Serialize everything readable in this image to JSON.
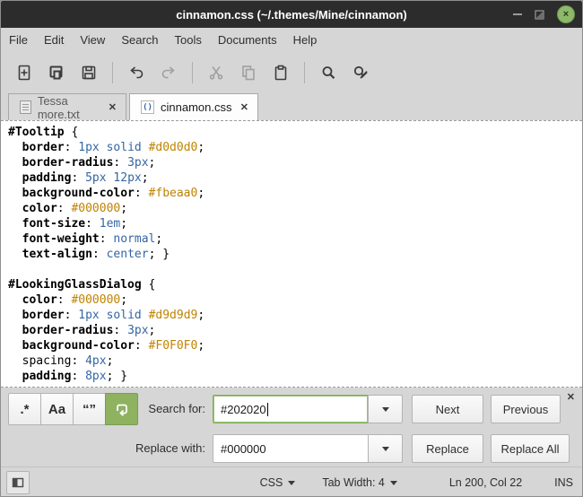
{
  "window": {
    "title": "cinnamon.css (~/.themes/Mine/cinnamon)",
    "controls": {
      "minimize": "minimize-icon",
      "maximize": "maximize-icon",
      "close": "×"
    }
  },
  "menubar": {
    "items": [
      "File",
      "Edit",
      "View",
      "Search",
      "Tools",
      "Documents",
      "Help"
    ]
  },
  "toolbar": {
    "buttons": [
      {
        "name": "new-document",
        "icon": "new-document-icon",
        "enabled": true
      },
      {
        "name": "open",
        "icon": "open-documents-icon",
        "enabled": true
      },
      {
        "name": "save",
        "icon": "save-icon",
        "enabled": true
      },
      {
        "name": "undo",
        "icon": "undo-icon",
        "enabled": true
      },
      {
        "name": "redo",
        "icon": "redo-icon",
        "enabled": false
      },
      {
        "name": "cut",
        "icon": "cut-icon",
        "enabled": false
      },
      {
        "name": "copy",
        "icon": "copy-icon",
        "enabled": false
      },
      {
        "name": "paste",
        "icon": "paste-icon",
        "enabled": true
      },
      {
        "name": "find",
        "icon": "find-icon",
        "enabled": true
      },
      {
        "name": "find-replace",
        "icon": "find-replace-icon",
        "enabled": true
      }
    ]
  },
  "tabbar": {
    "tabs": [
      {
        "label": "Tessa more.txt",
        "icon": "text-file-icon",
        "close": "✕",
        "active": false
      },
      {
        "label": "cinnamon.css",
        "icon": "css-file-icon",
        "close": "✕",
        "active": true
      }
    ]
  },
  "editor": {
    "language": "css",
    "css_icon_glyph": "()",
    "lines": [
      [
        [
          "b",
          "#Tooltip"
        ],
        [
          "p",
          " {"
        ]
      ],
      [
        [
          "p",
          "  "
        ],
        [
          "b",
          "border"
        ],
        [
          "p",
          ": "
        ],
        [
          "v",
          "1px solid"
        ],
        [
          "p",
          " "
        ],
        [
          "h",
          "#d0d0d0"
        ],
        [
          "p",
          ";"
        ]
      ],
      [
        [
          "p",
          "  "
        ],
        [
          "b",
          "border-radius"
        ],
        [
          "p",
          ": "
        ],
        [
          "v",
          "3px"
        ],
        [
          "p",
          ";"
        ]
      ],
      [
        [
          "p",
          "  "
        ],
        [
          "b",
          "padding"
        ],
        [
          "p",
          ": "
        ],
        [
          "v",
          "5px 12px"
        ],
        [
          "p",
          ";"
        ]
      ],
      [
        [
          "p",
          "  "
        ],
        [
          "b",
          "background-color"
        ],
        [
          "p",
          ": "
        ],
        [
          "h",
          "#fbeaa0"
        ],
        [
          "p",
          ";"
        ]
      ],
      [
        [
          "p",
          "  "
        ],
        [
          "b",
          "color"
        ],
        [
          "p",
          ": "
        ],
        [
          "h",
          "#000000"
        ],
        [
          "p",
          ";"
        ]
      ],
      [
        [
          "p",
          "  "
        ],
        [
          "b",
          "font-size"
        ],
        [
          "p",
          ": "
        ],
        [
          "v",
          "1em"
        ],
        [
          "p",
          ";"
        ]
      ],
      [
        [
          "p",
          "  "
        ],
        [
          "b",
          "font-weight"
        ],
        [
          "p",
          ": "
        ],
        [
          "v",
          "normal"
        ],
        [
          "p",
          ";"
        ]
      ],
      [
        [
          "p",
          "  "
        ],
        [
          "b",
          "text-align"
        ],
        [
          "p",
          ": "
        ],
        [
          "v",
          "center"
        ],
        [
          "p",
          "; }"
        ]
      ],
      [],
      [
        [
          "b",
          "#LookingGlassDialog"
        ],
        [
          "p",
          " {"
        ]
      ],
      [
        [
          "p",
          "  "
        ],
        [
          "b",
          "color"
        ],
        [
          "p",
          ": "
        ],
        [
          "h",
          "#000000"
        ],
        [
          "p",
          ";"
        ]
      ],
      [
        [
          "p",
          "  "
        ],
        [
          "b",
          "border"
        ],
        [
          "p",
          ": "
        ],
        [
          "v",
          "1px solid"
        ],
        [
          "p",
          " "
        ],
        [
          "h",
          "#d9d9d9"
        ],
        [
          "p",
          ";"
        ]
      ],
      [
        [
          "p",
          "  "
        ],
        [
          "b",
          "border-radius"
        ],
        [
          "p",
          ": "
        ],
        [
          "v",
          "3px"
        ],
        [
          "p",
          ";"
        ]
      ],
      [
        [
          "p",
          "  "
        ],
        [
          "b",
          "background-color"
        ],
        [
          "p",
          ": "
        ],
        [
          "h",
          "#F0F0F0"
        ],
        [
          "p",
          ";"
        ]
      ],
      [
        [
          "p",
          "  spacing"
        ],
        [
          "p",
          ": "
        ],
        [
          "v",
          "4px"
        ],
        [
          "p",
          ";"
        ]
      ],
      [
        [
          "p",
          "  "
        ],
        [
          "b",
          "padding"
        ],
        [
          "p",
          ": "
        ],
        [
          "v",
          "8px"
        ],
        [
          "p",
          "; }"
        ]
      ]
    ]
  },
  "search_panel": {
    "toggles": [
      {
        "name": "regex",
        "label": ".*",
        "active": false
      },
      {
        "name": "match-case",
        "label": "Aa",
        "active": false
      },
      {
        "name": "whole-word",
        "label": "“”",
        "active": false
      },
      {
        "name": "wrap-around",
        "icon": "wrap-around-icon",
        "active": true
      }
    ],
    "search_label": "Search for:",
    "search_value": "#202020",
    "replace_label": "Replace with:",
    "replace_value": "#000000",
    "next_label": "Next",
    "previous_label": "Previous",
    "replace_button_label": "Replace",
    "replace_all_label": "Replace All",
    "close": "✕"
  },
  "status_bar": {
    "language": "CSS",
    "tab_width": "Tab Width: 4",
    "cursor_position": "Ln 200, Col 22",
    "mode": "INS"
  },
  "colors": {
    "titlebar_bg": "#2c2c2c",
    "panel_bg": "#d6d6d6",
    "accent_green": "#8fb261",
    "close_button_green": "#8cb96a",
    "syntax_value_blue": "#3465a4",
    "syntax_hex_orange": "#bf8300",
    "editor_bg": "#ffffff"
  }
}
